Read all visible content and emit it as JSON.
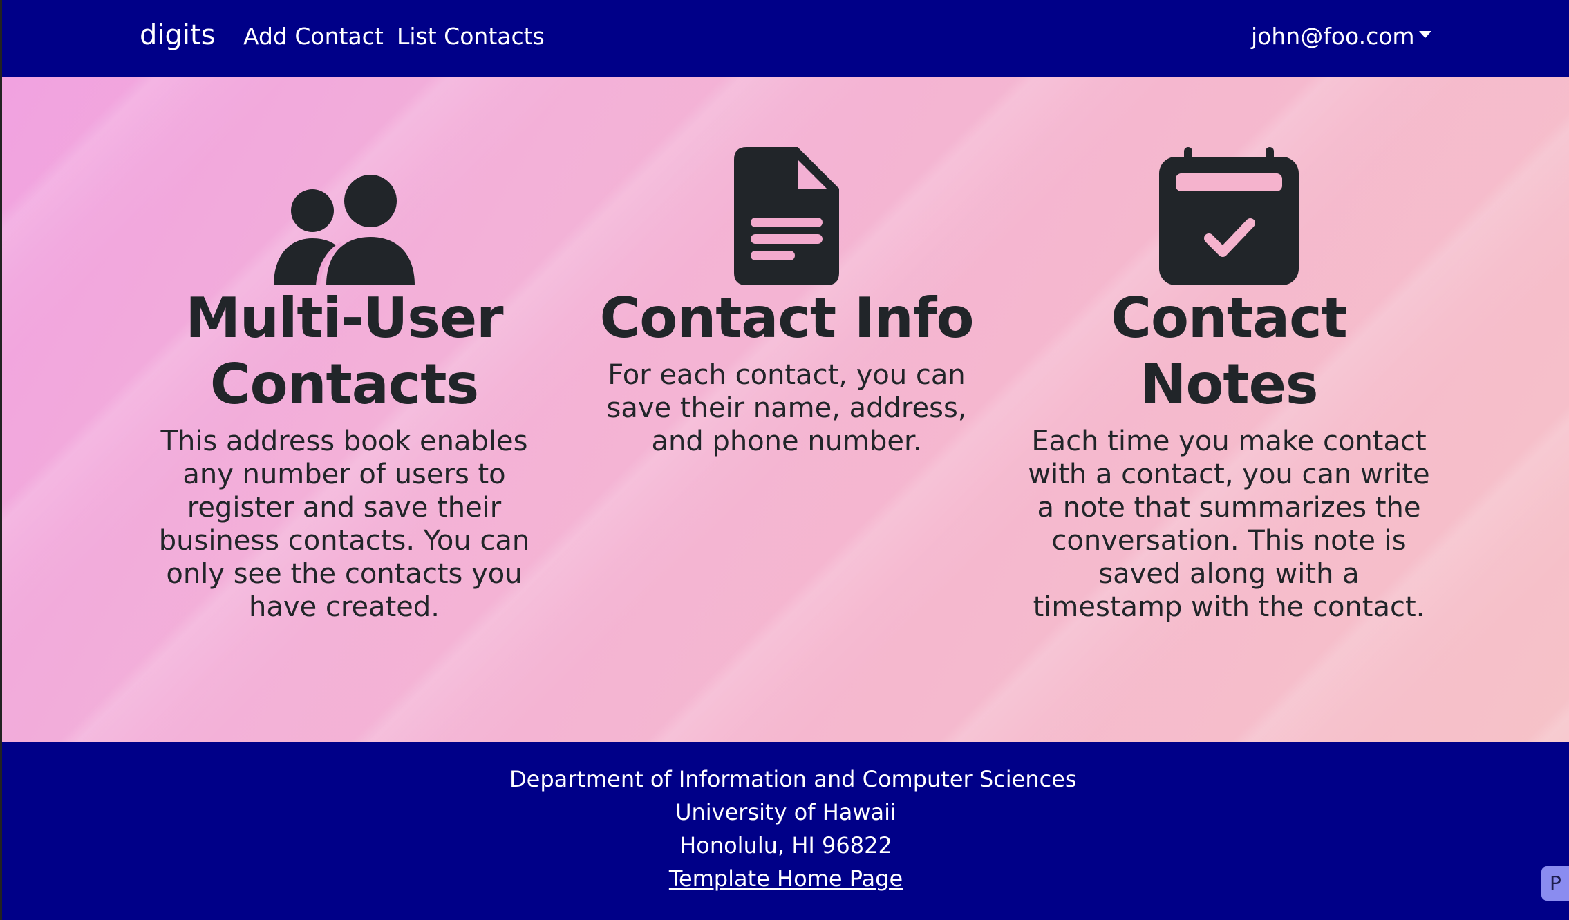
{
  "navbar": {
    "brand": "digits",
    "links": [
      {
        "label": "Add Contact"
      },
      {
        "label": "List Contacts"
      }
    ],
    "user": "john@foo.com"
  },
  "features": [
    {
      "icon": "users-icon",
      "title": "Multi-User Contacts",
      "text": "This address book enables any number of users to register and save their business contacts. You can only see the contacts you have created."
    },
    {
      "icon": "document-icon",
      "title": "Contact Info",
      "text": "For each contact, you can save their name, address, and phone number."
    },
    {
      "icon": "calendar-check-icon",
      "title": "Contact Notes",
      "text": "Each time you make contact with a contact, you can write a note that summarizes the conversation. This note is saved along with a timestamp with the contact."
    }
  ],
  "footer": {
    "line1": "Department of Information and Computer Sciences",
    "line2": "University of Hawaii",
    "line3": "Honolulu, HI 96822",
    "link": "Template Home Page"
  },
  "corner_button": "P",
  "colors": {
    "navbar": "#000088",
    "text_dark": "#212529",
    "icon_accent": "#f3a9cc"
  }
}
